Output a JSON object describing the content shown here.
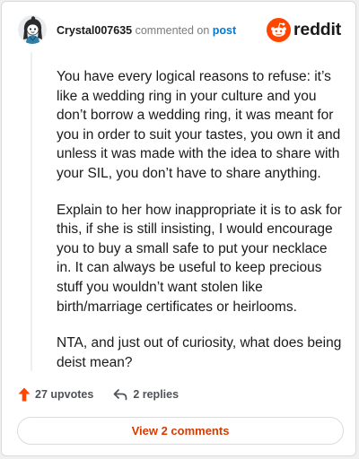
{
  "colors": {
    "brand_orange": "#ff4500",
    "link_blue": "#0079d3",
    "upvote_orange": "#ff4500",
    "button_text": "#d93a00"
  },
  "header": {
    "author": "Crystal007635",
    "action_text": "commented on",
    "post_link": "post",
    "brand_name": "reddit",
    "avatar_icon": "snoo-avatar-icon",
    "brand_icon": "reddit-logo-icon"
  },
  "comment": {
    "paragraphs": [
      "You have every logical reasons to refuse: it’s like a wedding ring in your culture and you don’t borrow a wedding ring, it was meant for you in order to suit your tastes, you own it and unless it was made with the idea to share with your SIL, you don’t have to share anything.",
      "Explain to her how inappropriate it is to ask for this, if she is still insisting, I would encourage you to buy a small safe to put your necklace in. It can always be useful to keep precious stuff you wouldn’t want stolen like birth/marriage certificates or heirlooms.",
      "NTA, and just out of curiosity, what does being deist mean?"
    ]
  },
  "actions": {
    "upvotes": "27 upvotes",
    "replies": "2 replies",
    "upvote_icon": "upvote-arrow-icon",
    "reply_icon": "reply-arrow-icon"
  },
  "footer": {
    "view_comments": "View 2 comments"
  }
}
